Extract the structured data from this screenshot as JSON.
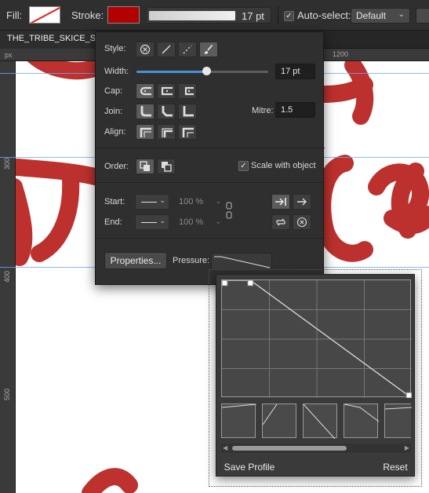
{
  "toolbar": {
    "fill_label": "Fill:",
    "stroke_label": "Stroke:",
    "stroke_width": "17 pt",
    "auto_select_label": "Auto-select:",
    "auto_select_value": "Default",
    "fill_color": "#ffffff",
    "stroke_color": "#b30000"
  },
  "document": {
    "tab_title": "THE_TRIBE_SKICE_SLOVA"
  },
  "rulers": {
    "unit": "px",
    "h_marks": [
      "1200"
    ],
    "v_marks": [
      "300",
      "400",
      "500"
    ]
  },
  "stroke_panel": {
    "style_label": "Style:",
    "style_options": [
      "none",
      "solid",
      "dashed",
      "brush"
    ],
    "width_label": "Width:",
    "width_value": "17 pt",
    "width_fraction": 0.53,
    "cap_label": "Cap:",
    "join_label": "Join:",
    "mitre_label": "Mitre:",
    "mitre_value": "1.5",
    "align_label": "Align:",
    "order_label": "Order:",
    "scale_with_object_label": "Scale with object",
    "scale_with_object_checked": true,
    "start_label": "Start:",
    "end_label": "End:",
    "start_percent": "100 %",
    "end_percent": "100 %",
    "properties_button": "Properties...",
    "pressure_label": "Pressure:"
  },
  "pressure_popup": {
    "save_profile_button": "Save Profile",
    "reset_button": "Reset",
    "curve_points": [
      [
        0.0,
        1.0
      ],
      [
        0.15,
        1.0
      ],
      [
        1.0,
        0.0
      ]
    ]
  },
  "colors": {
    "brush_red": "#b8221e",
    "accent_blue": "#4a8fd8",
    "guide_blue": "#6ea6ff"
  }
}
